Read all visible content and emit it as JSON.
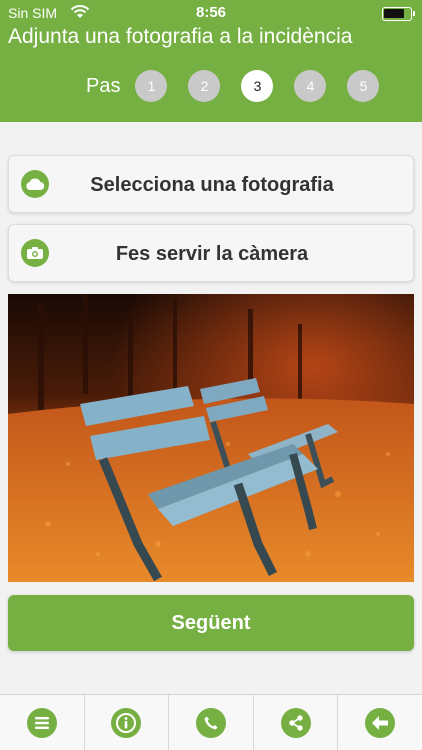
{
  "status_bar": {
    "carrier": "Sin SIM",
    "time": "8:56"
  },
  "header": {
    "title": "Adjunta una fotografia a la incidència"
  },
  "steps": {
    "label": "Pas",
    "items": [
      "1",
      "2",
      "3",
      "4",
      "5"
    ],
    "active_step": "3"
  },
  "actions": {
    "select_photo": {
      "label": "Selecciona una fotografia",
      "icon": "cloud-icon"
    },
    "use_camera": {
      "label": "Fes servir la càmera",
      "icon": "camera-icon"
    }
  },
  "next_button": {
    "label": "Següent"
  },
  "tabbar": {
    "items": [
      "menu-icon",
      "info-icon",
      "phone-icon",
      "share-icon",
      "back-arrow-icon"
    ]
  },
  "colors": {
    "accent": "#76b043",
    "step_inactive": "#c9c9c9"
  }
}
